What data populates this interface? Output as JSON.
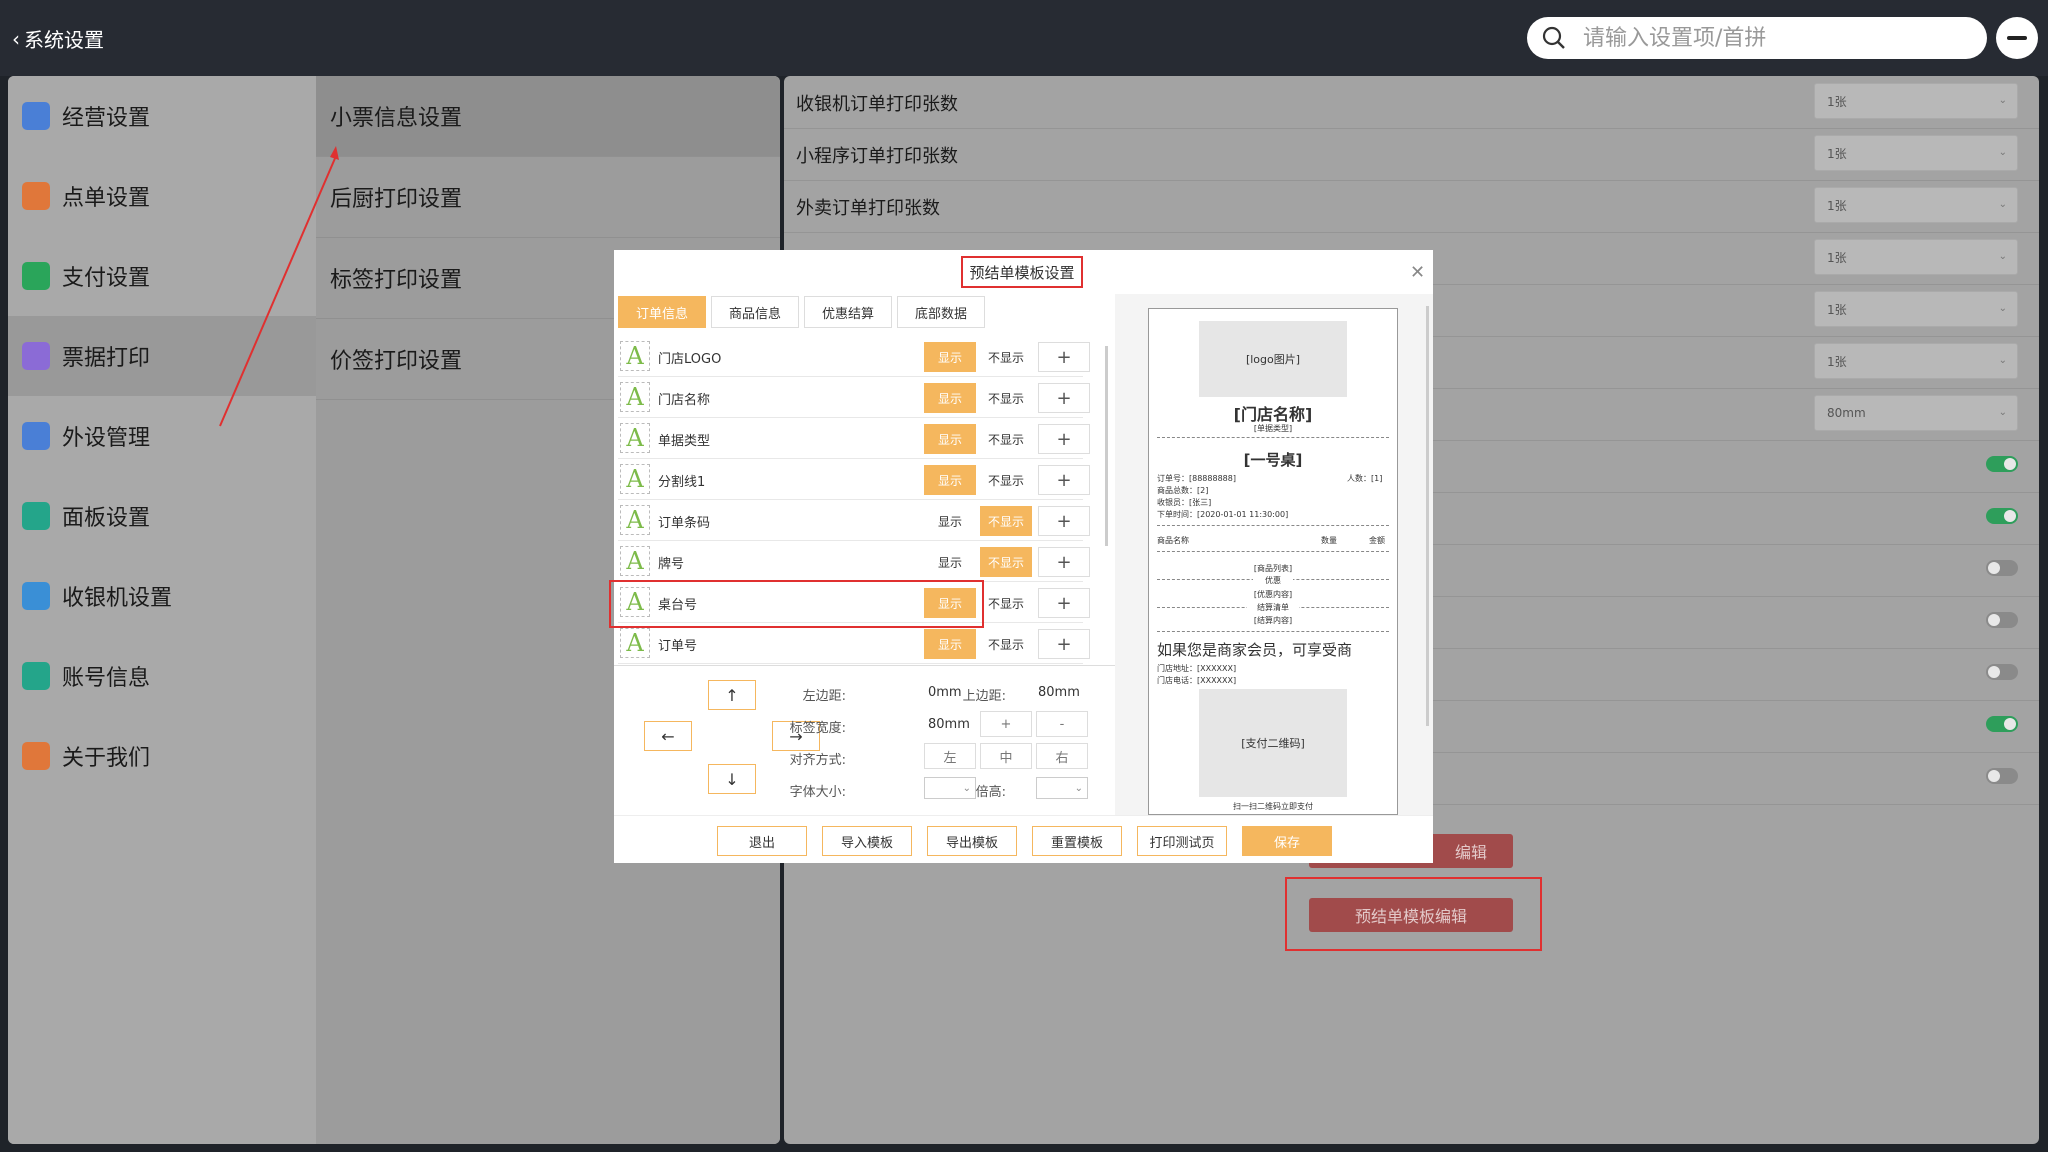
{
  "header": {
    "back_label": "系统设置",
    "search_placeholder": "请输入设置项/首拼"
  },
  "nav_primary": [
    {
      "label": "经营设置",
      "icon": "store-icon",
      "color": "#4a7fd6"
    },
    {
      "label": "点单设置",
      "icon": "order-icon",
      "color": "#e0773a"
    },
    {
      "label": "支付设置",
      "icon": "yuan-icon",
      "color": "#2aa55a"
    },
    {
      "label": "票据打印",
      "icon": "printer-icon",
      "color": "#8b6bd6",
      "active": true
    },
    {
      "label": "外设管理",
      "icon": "device-icon",
      "color": "#4a7fd6"
    },
    {
      "label": "面板设置",
      "icon": "panel-icon",
      "color": "#24a58a"
    },
    {
      "label": "收银机设置",
      "icon": "cashier-icon",
      "color": "#3a8fd6"
    },
    {
      "label": "账号信息",
      "icon": "account-icon",
      "color": "#24a58a"
    },
    {
      "label": "关于我们",
      "icon": "info-icon",
      "color": "#e0773a"
    }
  ],
  "nav_secondary": [
    {
      "label": "小票信息设置",
      "active": true
    },
    {
      "label": "后厨打印设置"
    },
    {
      "label": "标签打印设置"
    },
    {
      "label": "价签打印设置"
    }
  ],
  "settings": [
    {
      "label": "收银机订单打印张数",
      "value": "1张"
    },
    {
      "label": "小程序订单打印张数",
      "value": "1张"
    },
    {
      "label": "外卖订单打印张数",
      "value": "1张"
    },
    {
      "label": "",
      "value": "1张"
    },
    {
      "label": "",
      "value": "1张"
    },
    {
      "label": "",
      "value": "1张"
    },
    {
      "label": "",
      "value": "80mm"
    }
  ],
  "toggles": [
    true,
    true,
    false,
    false,
    false,
    true,
    false
  ],
  "right_buttons": {
    "partial": "编辑",
    "prebill": "预结单模板编辑"
  },
  "modal": {
    "title": "预结单模板设置",
    "tabs": [
      "订单信息",
      "商品信息",
      "优惠结算",
      "底部数据"
    ],
    "show_label": "显示",
    "hide_label": "不显示",
    "plus": "+",
    "fields": [
      {
        "name": "门店LOGO",
        "show": true
      },
      {
        "name": "门店名称",
        "show": true
      },
      {
        "name": "单据类型",
        "show": true
      },
      {
        "name": "分割线1",
        "show": true
      },
      {
        "name": "订单条码",
        "show": false
      },
      {
        "name": "牌号",
        "show": false
      },
      {
        "name": "桌台号",
        "show": true
      },
      {
        "name": "订单号",
        "show": true
      }
    ],
    "arrows": {
      "up": "↑",
      "left": "←",
      "right": "→",
      "down": "↓"
    },
    "left_margin_label": "左边距:",
    "left_margin": "0mm",
    "top_margin_label": "上边距:",
    "top_margin": "80mm",
    "label_width_label": "标签宽度:",
    "label_width": "80mm",
    "plus_btn": "+",
    "minus_btn": "-",
    "align_label": "对齐方式:",
    "align_options": [
      "左",
      "中",
      "右"
    ],
    "font_size_label": "字体大小:",
    "height_label": "倍高:",
    "footer_buttons": [
      "退出",
      "导入模板",
      "导出模板",
      "重置模板",
      "打印测试页",
      "保存"
    ]
  },
  "receipt": {
    "logo": "[logo图片]",
    "store_name": "[门店名称]",
    "bill_type": "[单据类型]",
    "table": "[一号桌]",
    "order_no": "订单号：[88888888]",
    "people": "人数：[1]",
    "goods_total": "商品总数：[2]",
    "cashier": "收银员：[张三]",
    "order_time": "下单时间：[2020-01-01 11:30:00]",
    "col_name": "商品名称",
    "col_qty": "数量",
    "col_amount": "金额",
    "goods_list": "[商品列表]",
    "discount": "优惠",
    "discount_content": "[优惠内容]",
    "settle_list": "结算清单",
    "settle_content": "[结算内容]",
    "member_text": "如果您是商家会员，可享受商",
    "store_addr": "门店地址：[XXXXXX]",
    "store_phone": "门店电话：[XXXXXX]",
    "qr": "[支付二维码]",
    "scan_text": "扫一扫二维码立即支付"
  }
}
